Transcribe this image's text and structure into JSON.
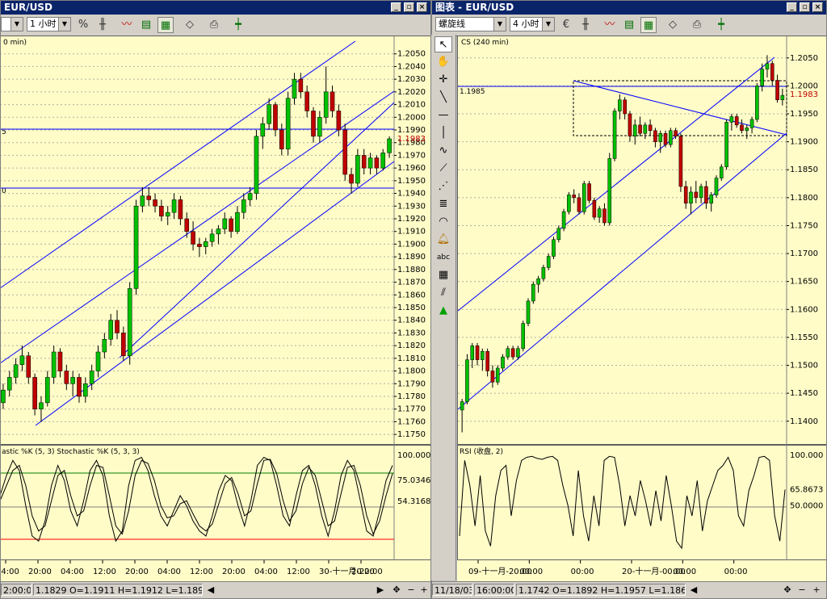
{
  "left_window": {
    "title": "EUR/USD",
    "timeframe": "1 小时",
    "chart_label": "0 min)",
    "hline_label_1": "5",
    "hline_label_2": "0",
    "indicator_label": "astic %K (5, 3)  Stochastic %K (5, 3, 3)",
    "price_ticks": [
      "1.2050",
      "1.2040",
      "1.2030",
      "1.2020",
      "1.2010",
      "1.2000",
      "1.1990",
      "1.1980",
      "1.1970",
      "1.1960",
      "1.1950",
      "1.1940",
      "1.1930",
      "1.1920",
      "1.1910",
      "1.1900",
      "1.1890",
      "1.1880",
      "1.1870",
      "1.1860",
      "1.1850",
      "1.1840",
      "1.1830",
      "1.1820",
      "1.1810",
      "1.1800",
      "1.1790",
      "1.1780",
      "1.1770",
      "1.1760",
      "1.1750"
    ],
    "current_price": "1.1983",
    "osc_ticks": [
      "100.000",
      "75.0346",
      "54.3168"
    ],
    "time_ticks": [
      "04:00",
      "20:00",
      "04:00",
      "12:00",
      "20:00",
      "04:00",
      "12:00",
      "20:00",
      "04:00",
      "12:00",
      "30-十一月-22:00",
      "20:00"
    ],
    "status": {
      "time": "2:00:00",
      "open_high_low": "1.1829  O=1.1911  H=1.1912  L=1.1899  C"
    }
  },
  "right_window": {
    "title": "图表 - EUR/USD",
    "tool_select": "螺旋线",
    "timeframe": "4 小时",
    "chart_label": "CS (240 min)",
    "hline_label": "1.1985",
    "indicator_label": "RSI (收盘, 2)",
    "price_ticks": [
      "1.2050",
      "1.2000",
      "1.1950",
      "1.1900",
      "1.1850",
      "1.1800",
      "1.1750",
      "1.1700",
      "1.1650",
      "1.1600",
      "1.1550",
      "1.1500",
      "1.1450",
      "1.1400"
    ],
    "current_price": "1.1983",
    "osc_ticks": [
      "100.000",
      "65.8673",
      "50.0000"
    ],
    "time_ticks": [
      "09-十一月-20:00",
      "00:00",
      "00:00",
      "20-十一月-00:00",
      "00:00",
      "00:00"
    ],
    "status": {
      "date": "11/18/03",
      "time": "16:00:00",
      "open_high_low": "1.1742  O=1.1892  H=1.1957  L=1.1868  C"
    }
  },
  "colors": {
    "chart_bg": "#fffcc8",
    "bull": "#00c000",
    "bear": "#c00000",
    "trendline": "#0000ff",
    "price_red": "#c00000"
  },
  "chart_data": [
    {
      "type": "candlestick",
      "title": "EUR/USD 1 hour",
      "ylim": [
        1.1745,
        1.206
      ],
      "candles": [
        [
          1.1775,
          1.179,
          1.177,
          1.1785
        ],
        [
          1.1785,
          1.18,
          1.178,
          1.1795
        ],
        [
          1.1795,
          1.181,
          1.179,
          1.1805
        ],
        [
          1.1805,
          1.182,
          1.18,
          1.1812
        ],
        [
          1.1812,
          1.1815,
          1.179,
          1.1795
        ],
        [
          1.1795,
          1.1798,
          1.1765,
          1.177
        ],
        [
          1.177,
          1.178,
          1.176,
          1.1775
        ],
        [
          1.1775,
          1.18,
          1.1772,
          1.1795
        ],
        [
          1.1795,
          1.182,
          1.179,
          1.1815
        ],
        [
          1.1815,
          1.1818,
          1.1795,
          1.18
        ],
        [
          1.18,
          1.1805,
          1.1785,
          1.179
        ],
        [
          1.179,
          1.18,
          1.178,
          1.1795
        ],
        [
          1.1795,
          1.1798,
          1.1775,
          1.178
        ],
        [
          1.178,
          1.1795,
          1.1775,
          1.179
        ],
        [
          1.179,
          1.1805,
          1.1785,
          1.18
        ],
        [
          1.18,
          1.182,
          1.1795,
          1.1815
        ],
        [
          1.1815,
          1.183,
          1.181,
          1.1825
        ],
        [
          1.1825,
          1.1845,
          1.182,
          1.184
        ],
        [
          1.184,
          1.1848,
          1.1825,
          1.183
        ],
        [
          1.183,
          1.1835,
          1.1808,
          1.1812
        ],
        [
          1.1812,
          1.187,
          1.1805,
          1.1865
        ],
        [
          1.1865,
          1.1935,
          1.186,
          1.193
        ],
        [
          1.193,
          1.1945,
          1.1925,
          1.1938
        ],
        [
          1.1938,
          1.1945,
          1.193,
          1.1935
        ],
        [
          1.1935,
          1.194,
          1.1925,
          1.193
        ],
        [
          1.193,
          1.1935,
          1.1918,
          1.1922
        ],
        [
          1.1922,
          1.193,
          1.1915,
          1.1925
        ],
        [
          1.1925,
          1.194,
          1.192,
          1.1935
        ],
        [
          1.1935,
          1.1938,
          1.1915,
          1.192
        ],
        [
          1.192,
          1.1925,
          1.1905,
          1.191
        ],
        [
          1.191,
          1.1918,
          1.1895,
          1.19
        ],
        [
          1.19,
          1.1905,
          1.189,
          1.1898
        ],
        [
          1.1898,
          1.1905,
          1.1892,
          1.1902
        ],
        [
          1.1902,
          1.1912,
          1.1898,
          1.1908
        ],
        [
          1.1908,
          1.1915,
          1.19,
          1.1912
        ],
        [
          1.1912,
          1.1925,
          1.1908,
          1.192
        ],
        [
          1.192,
          1.1922,
          1.1905,
          1.191
        ],
        [
          1.191,
          1.193,
          1.1908,
          1.1925
        ],
        [
          1.1925,
          1.194,
          1.192,
          1.1935
        ],
        [
          1.1935,
          1.1945,
          1.193,
          1.194
        ],
        [
          1.194,
          1.199,
          1.1935,
          1.1985
        ],
        [
          1.1985,
          1.2,
          1.1975,
          1.1995
        ],
        [
          1.1995,
          1.2015,
          1.199,
          1.201
        ],
        [
          1.201,
          1.2012,
          1.1985,
          1.199
        ],
        [
          1.199,
          1.1995,
          1.197,
          1.1975
        ],
        [
          1.1975,
          1.202,
          1.197,
          1.2015
        ],
        [
          1.2015,
          1.2035,
          1.201,
          1.203
        ],
        [
          1.203,
          1.2035,
          1.2015,
          1.202
        ],
        [
          1.202,
          1.2025,
          1.2,
          1.2005
        ],
        [
          1.2005,
          1.2008,
          1.198,
          1.1985
        ],
        [
          1.1985,
          1.2005,
          1.198,
          1.2
        ],
        [
          1.2,
          1.204,
          1.1995,
          1.202
        ],
        [
          1.202,
          1.2025,
          1.2,
          1.2005
        ],
        [
          1.2005,
          1.201,
          1.1985,
          1.199
        ],
        [
          1.199,
          1.1995,
          1.195,
          1.1955
        ],
        [
          1.1955,
          1.196,
          1.194,
          1.1948
        ],
        [
          1.1948,
          1.1975,
          1.1945,
          1.197
        ],
        [
          1.197,
          1.1975,
          1.1955,
          1.196
        ],
        [
          1.196,
          1.1972,
          1.1955,
          1.1968
        ],
        [
          1.1968,
          1.197,
          1.1955,
          1.196
        ],
        [
          1.196,
          1.1975,
          1.1958,
          1.1972
        ],
        [
          1.1972,
          1.1985,
          1.1968,
          1.1983
        ]
      ],
      "stochastic_k": [
        60,
        80,
        95,
        85,
        50,
        20,
        15,
        35,
        70,
        90,
        75,
        45,
        30,
        55,
        85,
        95,
        80,
        40,
        15,
        25,
        70,
        95,
        98,
        85,
        60,
        40,
        30,
        45,
        60,
        50,
        35,
        25,
        20,
        40,
        65,
        80,
        75,
        50,
        30,
        55,
        90,
        98,
        95,
        70,
        40,
        30,
        60,
        85,
        90,
        70,
        40,
        20,
        45,
        80,
        95,
        85,
        55,
        25,
        20,
        45,
        75,
        90
      ],
      "stochastic_d": [
        55,
        70,
        85,
        90,
        70,
        40,
        25,
        30,
        55,
        80,
        85,
        60,
        40,
        45,
        70,
        90,
        88,
        60,
        30,
        22,
        45,
        80,
        95,
        92,
        75,
        50,
        38,
        40,
        52,
        55,
        42,
        30,
        25,
        32,
        52,
        72,
        78,
        62,
        40,
        45,
        72,
        95,
        96,
        82,
        55,
        35,
        45,
        72,
        88,
        80,
        55,
        30,
        35,
        62,
        88,
        90,
        70,
        40,
        22,
        35,
        60,
        82
      ]
    },
    {
      "type": "candlestick",
      "title": "EUR/USD 4 hours",
      "ylim": [
        1.1365,
        1.208
      ],
      "candles": [
        [
          1.142,
          1.144,
          1.138,
          1.1435
        ],
        [
          1.1435,
          1.152,
          1.143,
          1.151
        ],
        [
          1.151,
          1.154,
          1.1495,
          1.1535
        ],
        [
          1.1535,
          1.154,
          1.15,
          1.151
        ],
        [
          1.151,
          1.153,
          1.149,
          1.1525
        ],
        [
          1.1525,
          1.153,
          1.148,
          1.149
        ],
        [
          1.149,
          1.15,
          1.146,
          1.147
        ],
        [
          1.147,
          1.15,
          1.1465,
          1.1495
        ],
        [
          1.1495,
          1.152,
          1.149,
          1.1515
        ],
        [
          1.1515,
          1.1535,
          1.151,
          1.153
        ],
        [
          1.153,
          1.1535,
          1.151,
          1.1515
        ],
        [
          1.1515,
          1.1535,
          1.151,
          1.153
        ],
        [
          1.153,
          1.158,
          1.1525,
          1.1575
        ],
        [
          1.1575,
          1.162,
          1.157,
          1.1615
        ],
        [
          1.1615,
          1.165,
          1.161,
          1.1645
        ],
        [
          1.1645,
          1.166,
          1.163,
          1.1655
        ],
        [
          1.1655,
          1.168,
          1.165,
          1.1675
        ],
        [
          1.1675,
          1.17,
          1.167,
          1.1695
        ],
        [
          1.1695,
          1.173,
          1.169,
          1.1725
        ],
        [
          1.1725,
          1.175,
          1.172,
          1.1745
        ],
        [
          1.1745,
          1.178,
          1.174,
          1.1775
        ],
        [
          1.1775,
          1.181,
          1.177,
          1.1805
        ],
        [
          1.1805,
          1.1815,
          1.179,
          1.18
        ],
        [
          1.18,
          1.1808,
          1.177,
          1.1775
        ],
        [
          1.1775,
          1.183,
          1.177,
          1.1825
        ],
        [
          1.1825,
          1.183,
          1.179,
          1.1795
        ],
        [
          1.1795,
          1.18,
          1.176,
          1.1765
        ],
        [
          1.1765,
          1.1785,
          1.1755,
          1.178
        ],
        [
          1.178,
          1.179,
          1.175,
          1.1755
        ],
        [
          1.1755,
          1.188,
          1.175,
          1.187
        ],
        [
          1.187,
          1.196,
          1.1865,
          1.1955
        ],
        [
          1.1955,
          1.1985,
          1.194,
          1.1975
        ],
        [
          1.1975,
          1.198,
          1.194,
          1.195
        ],
        [
          1.195,
          1.1955,
          1.19,
          1.191
        ],
        [
          1.191,
          1.194,
          1.1895,
          1.193
        ],
        [
          1.193,
          1.1945,
          1.191,
          1.1915
        ],
        [
          1.1915,
          1.1935,
          1.1905,
          1.193
        ],
        [
          1.193,
          1.194,
          1.191,
          1.192
        ],
        [
          1.192,
          1.1925,
          1.189,
          1.19
        ],
        [
          1.19,
          1.192,
          1.188,
          1.1915
        ],
        [
          1.1915,
          1.192,
          1.189,
          1.1895
        ],
        [
          1.1895,
          1.1925,
          1.189,
          1.192
        ],
        [
          1.192,
          1.1925,
          1.1905,
          1.191
        ],
        [
          1.191,
          1.1915,
          1.181,
          1.182
        ],
        [
          1.182,
          1.183,
          1.178,
          1.179
        ],
        [
          1.179,
          1.182,
          1.177,
          1.181
        ],
        [
          1.181,
          1.183,
          1.179,
          1.18
        ],
        [
          1.18,
          1.1825,
          1.179,
          1.182
        ],
        [
          1.182,
          1.183,
          1.178,
          1.179
        ],
        [
          1.179,
          1.181,
          1.1775,
          1.1805
        ],
        [
          1.1805,
          1.184,
          1.18,
          1.1835
        ],
        [
          1.1835,
          1.186,
          1.183,
          1.1855
        ],
        [
          1.1855,
          1.194,
          1.185,
          1.1935
        ],
        [
          1.1935,
          1.195,
          1.192,
          1.1945
        ],
        [
          1.1945,
          1.195,
          1.1925,
          1.193
        ],
        [
          1.193,
          1.194,
          1.1915,
          1.192
        ],
        [
          1.192,
          1.193,
          1.1905,
          1.1925
        ],
        [
          1.1925,
          1.1945,
          1.1915,
          1.194
        ],
        [
          1.194,
          1.2005,
          1.1935,
          1.2
        ],
        [
          1.2,
          1.204,
          1.199,
          1.203
        ],
        [
          1.203,
          1.2055,
          1.2015,
          1.204
        ],
        [
          1.204,
          1.2045,
          1.2,
          1.201
        ],
        [
          1.201,
          1.202,
          1.197,
          1.1975
        ],
        [
          1.1975,
          1.1995,
          1.1965,
          1.1983
        ]
      ],
      "rsi": [
        20,
        95,
        70,
        30,
        80,
        25,
        10,
        60,
        85,
        90,
        40,
        75,
        95,
        98,
        99,
        97,
        96,
        98,
        99,
        95,
        70,
        50,
        20,
        85,
        40,
        15,
        60,
        30,
        95,
        99,
        98,
        70,
        30,
        60,
        40,
        75,
        55,
        30,
        65,
        35,
        80,
        50,
        15,
        8,
        60,
        40,
        75,
        25,
        55,
        70,
        85,
        90,
        98,
        85,
        40,
        30,
        65,
        80,
        98,
        99,
        95,
        40,
        15,
        66
      ]
    }
  ]
}
